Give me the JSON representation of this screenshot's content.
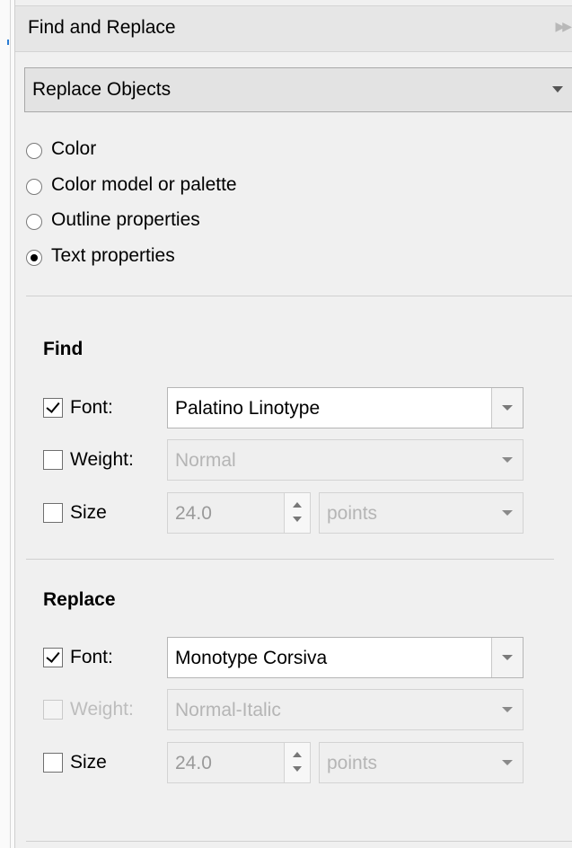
{
  "panel": {
    "title": "Find and Replace",
    "collapse_icon": "double-chevron-right-icon"
  },
  "mode": {
    "selected": "Replace Objects"
  },
  "options": [
    {
      "label": "Color",
      "checked": false
    },
    {
      "label": "Color model or palette",
      "checked": false
    },
    {
      "label": "Outline properties",
      "checked": false
    },
    {
      "label": "Text properties",
      "checked": true
    }
  ],
  "find": {
    "title": "Find",
    "font": {
      "label": "Font:",
      "checked": true,
      "value": "Palatino Linotype"
    },
    "weight": {
      "label": "Weight:",
      "checked": false,
      "value": "Normal"
    },
    "size": {
      "label": "Size",
      "checked": false,
      "value": "24.0",
      "unit": "points"
    }
  },
  "replace": {
    "title": "Replace",
    "font": {
      "label": "Font:",
      "checked": true,
      "value": "Monotype Corsiva"
    },
    "weight": {
      "label": "Weight:",
      "checked": false,
      "disabled": true,
      "value": "Normal-Italic"
    },
    "size": {
      "label": "Size",
      "checked": false,
      "value": "24.0",
      "unit": "points"
    }
  }
}
